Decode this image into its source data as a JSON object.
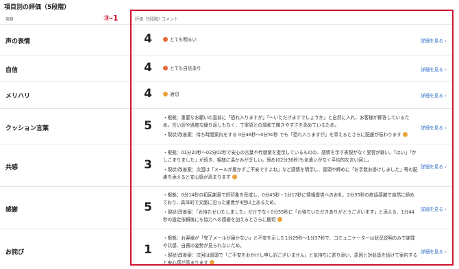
{
  "section_title": "項目別の評価（5段階）",
  "annotation": "③-1",
  "headers": {
    "item": "項目",
    "score": "評価（5段階）",
    "comment": "コメント"
  },
  "detail_label": "詳細を見る ›",
  "rows": [
    {
      "label": "声の表情",
      "score": "4",
      "comments": [
        "とても明るい"
      ],
      "icon": "smile-icon"
    },
    {
      "label": "自信",
      "score": "4",
      "comments": [
        "とても自信あり"
      ],
      "icon": "smile-icon"
    },
    {
      "label": "メリハリ",
      "score": "4",
      "comments": [
        "適切"
      ],
      "icon": "smile-icon"
    },
    {
      "label": "クッション言葉",
      "score": "5",
      "comments": [
        "・根拠：重要なお願いの直前に「恐れ入りますが」「〜いただけますでしょうか」と自然に入れ、お客様が即答しているため。言い訳や過度な繰り返しもなく、丁寧語との調和で聞きやすさを高めているため。",
        "・現状/改善案：待ち時間案内をする 0分46秒〜0分50秒 でも「恐れ入りますが」を添えるとさらに配慮が伝わります"
      ]
    },
    {
      "label": "共感",
      "score": "3",
      "comments": [
        "・根拠：01分20秒〜02分02秒で安心の言葉や代替案を提示しているものの、感情を示す表現がなく受容が弱い。「はい」「かしこまりました」が続き、相槌に温かみが乏しい。締め(02分36秒)も気遣いがなく平均的な言い回し。",
        "・現状/改善案：次回は「メールが届かずご不安ですよね」など感情を明示し、冒頭や締めに「お手数お掛けしました」等の配慮を添えると安心感が高まります"
      ]
    },
    {
      "label": "感謝",
      "score": "5",
      "comments": [
        "・根拠：0分14秒の初回謝意で好印象を形成し、0分45秒・1分17秒に情報提供へのお礼、2分35秒の終話感謝で自然に締めており、具体的で文脈に沿った謝意が4回以上あるため。",
        "・現状/改善案：「お待たせいたしました」だけでなく0分55秒に「お待ちいただきありがとうございます」と添える、1分44秒の設定依頼後にも協力への感謝を加えるとさらに観切"
      ]
    },
    {
      "label": "お詫び",
      "score": "1",
      "comments": [
        "・根拠：お客様が「完了メールが届かない」と不安を示した1分29秒〜1分37秒で、コミュニケーターは状況説明のみで謝罪や共感、自責の姿勢が見られないため。",
        "・現状/改善案：次回は冒頭で「ご不安をおかけし申し訳ございません」と気持ちに寄り添い、原因と対処策を続けて案内すると安心感が高まります"
      ]
    }
  ]
}
